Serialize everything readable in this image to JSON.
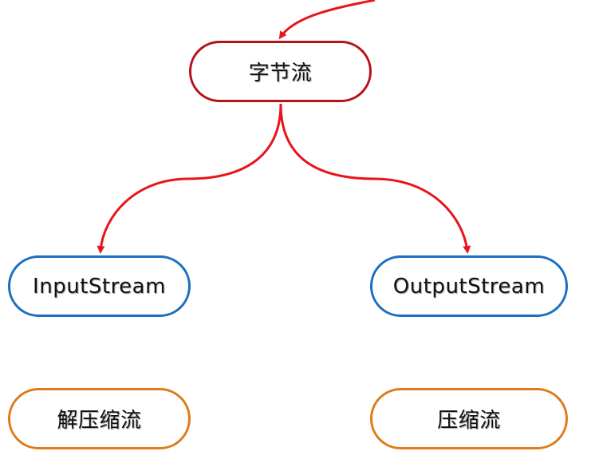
{
  "nodes": {
    "byte_stream": "字节流",
    "input_stream": "InputStream",
    "output_stream": "OutputStream",
    "decompress_stream": "解压缩流",
    "compress_stream": "压缩流"
  },
  "colors": {
    "arrow": "#e8141c",
    "root_border": "#b5121b",
    "stream_border": "#1a6fc0",
    "compress_border": "#e07b18"
  }
}
